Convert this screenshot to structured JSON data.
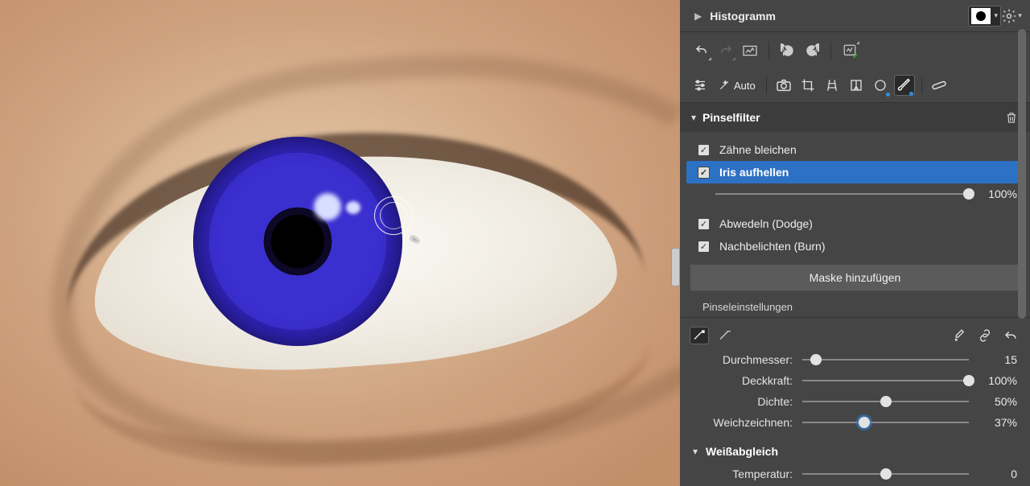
{
  "topbar": {
    "histogram_label": "Histogramm"
  },
  "toolbar2": {
    "auto_label": "Auto"
  },
  "section": {
    "title": "Pinselfilter",
    "filters": {
      "teeth": {
        "label": "Zähne bleichen",
        "checked": true
      },
      "iris": {
        "label": "Iris aufhellen",
        "checked": true,
        "value": "100%",
        "slider_pct": 100
      },
      "dodge": {
        "label": "Abwedeln (Dodge)",
        "checked": true
      },
      "burn": {
        "label": "Nachbelichten (Burn)",
        "checked": true
      }
    },
    "add_mask_label": "Maske hinzufügen"
  },
  "brush": {
    "heading": "Pinseleinstellungen",
    "diameter_label": "Durchmesser:",
    "diameter_value": "15",
    "diameter_pct": 8,
    "opacity_label": "Deckkraft:",
    "opacity_value": "100%",
    "opacity_pct": 100,
    "density_label": "Dichte:",
    "density_value": "50%",
    "density_pct": 50,
    "feather_label": "Weichzeichnen:",
    "feather_value": "37%",
    "feather_pct": 37
  },
  "wb": {
    "title": "Weißabgleich",
    "temp_label": "Temperatur:",
    "temp_value": "0",
    "temp_pct": 50
  }
}
